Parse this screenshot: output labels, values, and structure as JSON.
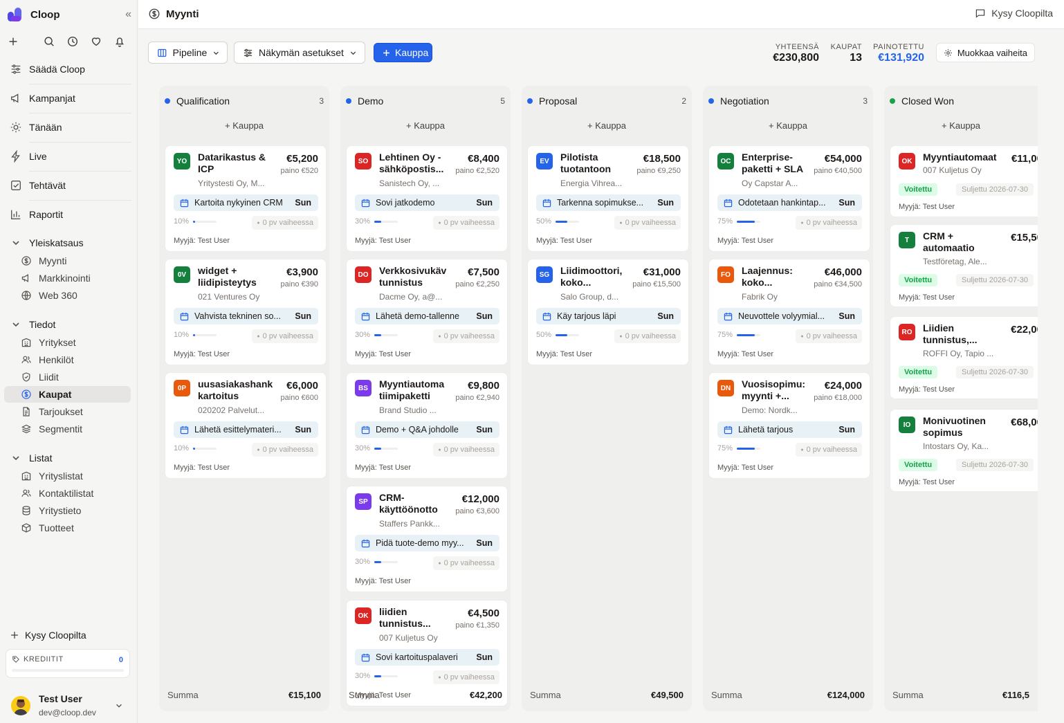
{
  "app": {
    "name": "Cloop"
  },
  "sidebar": {
    "top_nav": [
      {
        "label": "Säädä Cloop",
        "icon": "sliders-icon"
      },
      {
        "label": "Kampanjat",
        "icon": "megaphone-icon"
      },
      {
        "label": "Tänään",
        "icon": "sun-icon"
      },
      {
        "label": "Live",
        "icon": "bolt-icon"
      },
      {
        "label": "Tehtävät",
        "icon": "checkbox-icon"
      },
      {
        "label": "Raportit",
        "icon": "bar-chart-icon"
      }
    ],
    "groups": [
      {
        "label": "Yleiskatsaus",
        "items": [
          {
            "label": "Myynti",
            "icon": "dollar-circle-icon"
          },
          {
            "label": "Markkinointi",
            "icon": "megaphone-icon"
          },
          {
            "label": "Web 360",
            "icon": "globe-icon"
          }
        ]
      },
      {
        "label": "Tiedot",
        "items": [
          {
            "label": "Yritykset",
            "icon": "building-icon"
          },
          {
            "label": "Henkilöt",
            "icon": "users-icon"
          },
          {
            "label": "Liidit",
            "icon": "shield-icon"
          },
          {
            "label": "Kaupat",
            "icon": "dollar-circle-icon",
            "active": true
          },
          {
            "label": "Tarjoukset",
            "icon": "document-icon"
          },
          {
            "label": "Segmentit",
            "icon": "layers-icon"
          }
        ]
      },
      {
        "label": "Listat",
        "items": [
          {
            "label": "Yrityslistat",
            "icon": "building-icon"
          },
          {
            "label": "Kontaktilistat",
            "icon": "users-icon"
          },
          {
            "label": "Yritystieto",
            "icon": "database-icon"
          },
          {
            "label": "Tuotteet",
            "icon": "box-icon"
          }
        ]
      }
    ],
    "ask_label": "Kysy Cloopilta",
    "credits_label": "KREDIITIT",
    "credits_value": "0",
    "user": {
      "name": "Test User",
      "email": "dev@cloop.dev"
    }
  },
  "header": {
    "title": "Myynti",
    "ask_label": "Kysy Cloopilta"
  },
  "toolbar": {
    "view_label": "Pipeline",
    "settings_label": "Näkymän asetukset",
    "new_deal_label": "Kauppa",
    "stats": [
      {
        "label": "YHTEENSÄ",
        "value": "€230,800"
      },
      {
        "label": "KAUPAT",
        "value": "13"
      },
      {
        "label": "PAINOTETTU",
        "value": "€131,920"
      }
    ],
    "edit_stages_label": "Muokkaa vaiheita"
  },
  "colors": {
    "accent": "#2563eb",
    "won_green": "#16a34a"
  },
  "common": {
    "add_label": "+ Kauppa",
    "sum_label": "Summa",
    "stage_label": "0 pv vaiheessa",
    "seller_label": "Myyjä: Test User",
    "won_label": "Voitettu",
    "closed_label": "Suljettu 2026-07-30",
    "due_label": "Sun"
  },
  "columns": [
    {
      "name": "Qualification",
      "count": "3",
      "dot": "#2563eb",
      "total": "€15,100",
      "cards": [
        {
          "initials": "YO",
          "color": "#15803d",
          "title": "Datarikastus & ICP",
          "amount": "€5,200",
          "weight": "paino €520",
          "company": "Yritystesti Oy, M...",
          "task": "Kartoita nykyinen CRM",
          "prob": "10%",
          "prob_value": 0.1
        },
        {
          "initials": "0V",
          "color": "#15803d",
          "title": "widget + liidipisteytys",
          "amount": "€3,900",
          "weight": "paino €390",
          "company": "021 Ventures Oy",
          "task": "Vahvista tekninen so...",
          "prob": "10%",
          "prob_value": 0.1
        },
        {
          "initials": "0P",
          "color": "#ea580c",
          "title": "uusasiakashank kartoitus",
          "amount": "€6,000",
          "weight": "paino €600",
          "company": "020202 Palvelut...",
          "task": "Lähetä esittelymateri...",
          "prob": "10%",
          "prob_value": 0.1
        }
      ]
    },
    {
      "name": "Demo",
      "count": "5",
      "dot": "#2563eb",
      "total": "€42,200",
      "cards": [
        {
          "initials": "SO",
          "color": "#dc2626",
          "title": "Lehtinen Oy - sähköpostis...",
          "amount": "€8,400",
          "weight": "paino €2,520",
          "company": "Sanistech Oy, ...",
          "task": "Sovi jatkodemo",
          "prob": "30%",
          "prob_value": 0.3
        },
        {
          "initials": "DO",
          "color": "#dc2626",
          "title": "Verkkosivukäv tunnistus",
          "amount": "€7,500",
          "weight": "paino €2,250",
          "company": "Dacme Oy, a@...",
          "task": "Lähetä demo-tallenne",
          "prob": "30%",
          "prob_value": 0.3
        },
        {
          "initials": "BS",
          "color": "#7c3aed",
          "title": "Myyntiautoma tiimipaketti",
          "amount": "€9,800",
          "weight": "paino €2,940",
          "company": "Brand Studio ...",
          "task": "Demo + Q&A johdolle",
          "prob": "30%",
          "prob_value": 0.3
        },
        {
          "initials": "SP",
          "color": "#7c3aed",
          "title": "CRM-käyttöönotto",
          "amount": "€12,000",
          "weight": "paino €3,600",
          "company": "Staffers Pankk...",
          "task": "Pidä tuote-demo myy...",
          "prob": "30%",
          "prob_value": 0.3
        },
        {
          "initials": "OK",
          "color": "#dc2626",
          "title": "liidien tunnistus...",
          "amount": "€4,500",
          "weight": "paino €1,350",
          "company": "007 Kuljetus Oy",
          "task": "Sovi kartoituspalaveri",
          "prob": "30%",
          "prob_value": 0.3
        }
      ]
    },
    {
      "name": "Proposal",
      "count": "2",
      "dot": "#2563eb",
      "total": "€49,500",
      "cards": [
        {
          "initials": "EV",
          "color": "#2563eb",
          "title": "Pilotista tuotantoon",
          "amount": "€18,500",
          "weight": "paino €9,250",
          "company": "Energia Vihrea...",
          "task": "Tarkenna sopimukse...",
          "prob": "50%",
          "prob_value": 0.5
        },
        {
          "initials": "SG",
          "color": "#2563eb",
          "title": "Liidimoottori, koko...",
          "amount": "€31,000",
          "weight": "paino €15,500",
          "company": "Salo Group, d...",
          "task": "Käy tarjous läpi",
          "prob": "50%",
          "prob_value": 0.5
        }
      ]
    },
    {
      "name": "Negotiation",
      "count": "3",
      "dot": "#2563eb",
      "total": "€124,000",
      "cards": [
        {
          "initials": "OC",
          "color": "#15803d",
          "title": "Enterprise-paketti + SLA",
          "amount": "€54,000",
          "weight": "paino €40,500",
          "company": "Oy Capstar A...",
          "task": "Odotetaan hankintap...",
          "prob": "75%",
          "prob_value": 0.75
        },
        {
          "initials": "FO",
          "color": "#ea580c",
          "title": "Laajennus: koko...",
          "amount": "€46,000",
          "weight": "paino €34,500",
          "company": "Fabrik Oy",
          "task": "Neuvottele volyymial...",
          "prob": "75%",
          "prob_value": 0.75
        },
        {
          "initials": "DN",
          "color": "#ea580c",
          "title": "Vuosisopimu: myynti +...",
          "amount": "€24,000",
          "weight": "paino €18,000",
          "company": "Demo: Nordk...",
          "task": "Lähetä tarjous",
          "prob": "75%",
          "prob_value": 0.75
        }
      ]
    },
    {
      "name": "Closed Won",
      "count": "",
      "dot": "#16a34a",
      "total": "€116,5",
      "cards": [
        {
          "initials": "OK",
          "color": "#dc2626",
          "title": "Myyntiautomaat",
          "amount": "€11,00",
          "company": "007 Kuljetus Oy"
        },
        {
          "initials": "T",
          "color": "#15803d",
          "title": "CRM + automaatio",
          "amount": "€15,50",
          "company": "Testföretag, Ale..."
        },
        {
          "initials": "RO",
          "color": "#dc2626",
          "title": "Liidien tunnistus,...",
          "amount": "€22,00",
          "company": "ROFFI Oy, Tapio ..."
        },
        {
          "initials": "IO",
          "color": "#15803d",
          "title": "Monivuotinen sopimus",
          "amount": "€68,00",
          "company": "Intostars Oy, Ka..."
        }
      ]
    }
  ]
}
